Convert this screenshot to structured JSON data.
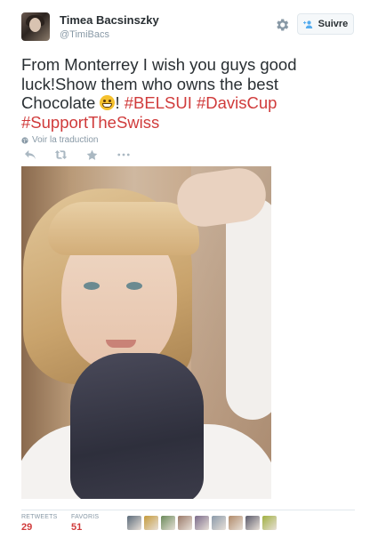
{
  "user": {
    "name": "Timea Bacsinszky",
    "handle": "@TimiBacs"
  },
  "follow_button": {
    "label": "Suivre",
    "icon": "person-plus-icon"
  },
  "settings_icon": "gear-icon",
  "tweet": {
    "text_part1": "From Monterrey I wish you guys good luck!Show them who owns the best Chocolate ",
    "emoji": "grinning-face-emoji",
    "text_part2": "! ",
    "hashtags": [
      "#BELSUI",
      "#DavisCup",
      "#SupportTheSwiss"
    ]
  },
  "translate_link": "Voir la traduction",
  "actions": [
    "reply-icon",
    "retweet-icon",
    "favorite-icon",
    "more-icon"
  ],
  "stats": {
    "retweets": {
      "label": "RETWEETS",
      "value": "29"
    },
    "favorites": {
      "label": "FAVORIS",
      "value": "51"
    }
  },
  "favoriter_colors": [
    "#5b6b7a",
    "#c49a3a",
    "#6a8a5a",
    "#9a7a6a",
    "#7a6a8a",
    "#8a9aaa",
    "#b08a6a",
    "#5a5a6a",
    "#a0b040"
  ],
  "colors": {
    "hashtag": "#d03b3b",
    "secondary_text": "#8899a6",
    "stat_value": "#d03b3b"
  }
}
